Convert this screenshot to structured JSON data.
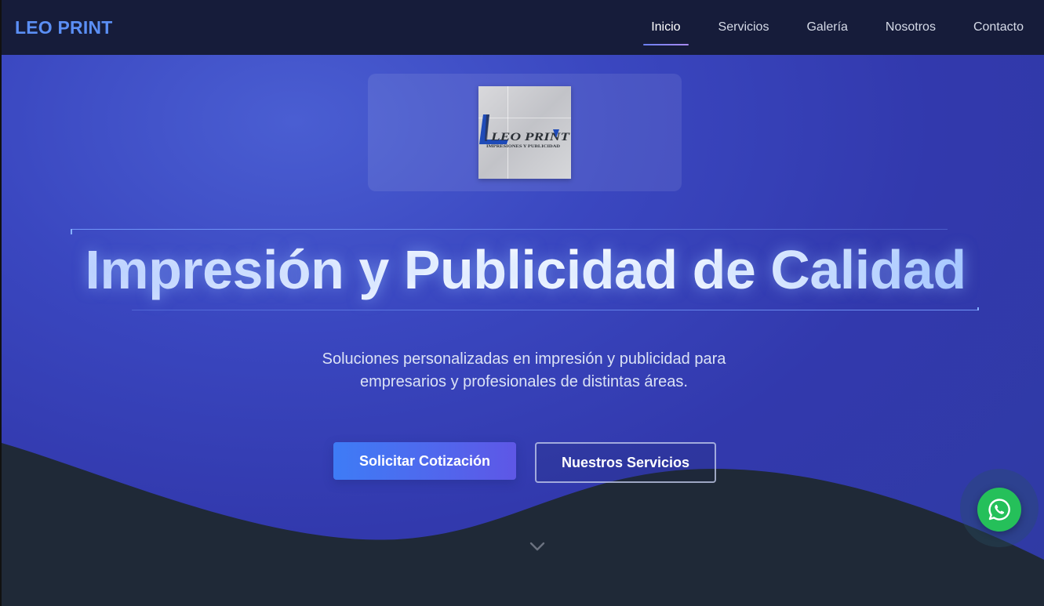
{
  "brand": {
    "name": "LEO PRINT"
  },
  "nav": {
    "items": [
      {
        "label": "Inicio",
        "active": true
      },
      {
        "label": "Servicios",
        "active": false
      },
      {
        "label": "Galería",
        "active": false
      },
      {
        "label": "Nosotros",
        "active": false
      },
      {
        "label": "Contacto",
        "active": false
      }
    ]
  },
  "logo": {
    "main_text": "LEO PRINT",
    "tagline": "IMPRESIONES Y PUBLICIDAD"
  },
  "hero": {
    "title": "Impresión y Publicidad de Calidad",
    "subtitle_line1": "Soluciones personalizadas en impresión y publicidad para",
    "subtitle_line2": "empresarios y profesionales de distintas áreas.",
    "primary_cta": "Solicitar Cotización",
    "secondary_cta": "Nuestros Servicios"
  },
  "icons": {
    "scroll": "chevron-down-icon",
    "whatsapp": "whatsapp-icon"
  },
  "colors": {
    "navbar_bg": "#161c3a",
    "brand": "#5b8ff5",
    "hero_bg": "#3239ad",
    "wave_bg": "#1f2937",
    "primary_gradient_start": "#3e7cf6",
    "primary_gradient_end": "#5e57e6",
    "whatsapp": "#25c05a"
  }
}
